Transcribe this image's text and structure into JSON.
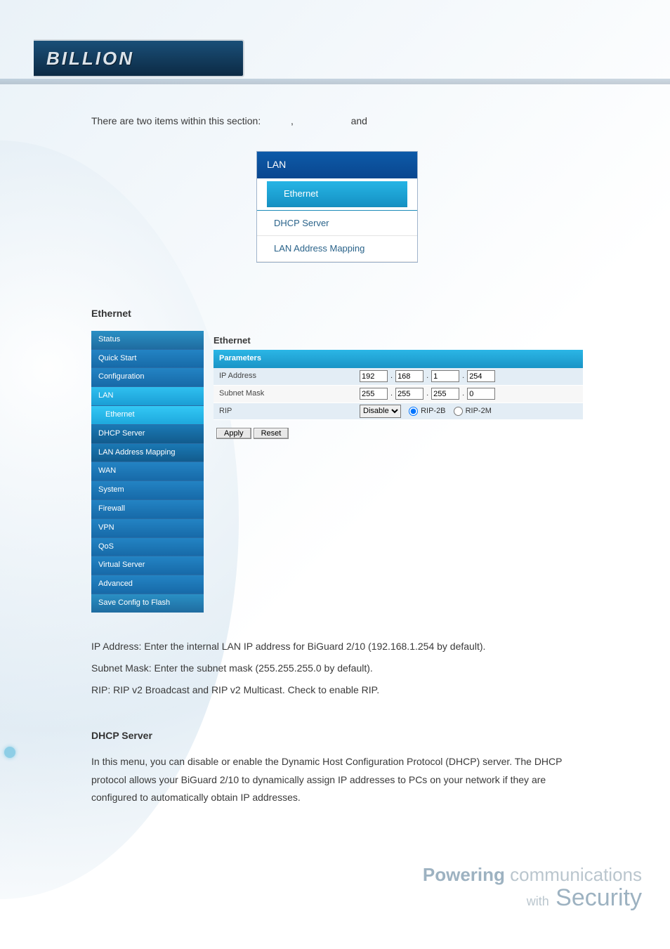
{
  "brand": {
    "name": "BILLION"
  },
  "doc": {
    "intro_pre": "There are two items within this section:",
    "intro_comma": ",",
    "intro_and": "and",
    "lan_menu": {
      "title": "LAN",
      "items": [
        "Ethernet",
        "DHCP Server",
        "LAN Address Mapping"
      ]
    },
    "ethernet_heading": "Ethernet",
    "ip_text": "IP Address: Enter the internal LAN IP address for BiGuard 2/10 (192.168.1.254 by default).",
    "subnet_text": "Subnet Mask: Enter the subnet mask (255.255.255.0 by default).",
    "rip_text": "RIP: RIP v2 Broadcast and RIP v2 Multicast. Check to enable RIP.",
    "dhcp_heading": "DHCP Server",
    "dhcp_text": "In this menu, you can disable or enable the Dynamic Host Configuration Protocol (DHCP) server. The DHCP protocol allows your BiGuard 2/10 to dynamically assign IP addresses to PCs on your network if they are configured to automatically obtain IP addresses."
  },
  "sidenav": {
    "items": [
      {
        "label": "Status",
        "cls": "n-top first"
      },
      {
        "label": "Quick Start",
        "cls": "n-cat"
      },
      {
        "label": "Configuration",
        "cls": "n-cat"
      },
      {
        "label": "LAN",
        "cls": "n-cat act"
      },
      {
        "label": "Ethernet",
        "cls": "n-sub act"
      },
      {
        "label": "DHCP Server",
        "cls": "n-sub"
      },
      {
        "label": "LAN Address Mapping",
        "cls": "n-sub"
      },
      {
        "label": "WAN",
        "cls": "n-cat"
      },
      {
        "label": "System",
        "cls": "n-cat"
      },
      {
        "label": "Firewall",
        "cls": "n-cat"
      },
      {
        "label": "VPN",
        "cls": "n-cat"
      },
      {
        "label": "QoS",
        "cls": "n-cat"
      },
      {
        "label": "Virtual Server",
        "cls": "n-cat"
      },
      {
        "label": "Advanced",
        "cls": "n-cat"
      },
      {
        "label": "Save Config to Flash",
        "cls": "n-top"
      }
    ]
  },
  "panel": {
    "title": "Ethernet",
    "section": "Parameters",
    "rows": {
      "ip": {
        "label": "IP Address",
        "octets": [
          "192",
          "168",
          "1",
          "254"
        ]
      },
      "mask": {
        "label": "Subnet Mask",
        "octets": [
          "255",
          "255",
          "255",
          "0"
        ]
      },
      "rip": {
        "label": "RIP",
        "select": "Disable",
        "opt_a": "RIP-2B",
        "opt_b": "RIP-2M"
      }
    },
    "buttons": {
      "apply": "Apply",
      "reset": "Reset"
    }
  },
  "slogan": {
    "line1_a": "Powering",
    "line1_b": "communications",
    "line2_a": "with",
    "line2_b": "Security"
  }
}
